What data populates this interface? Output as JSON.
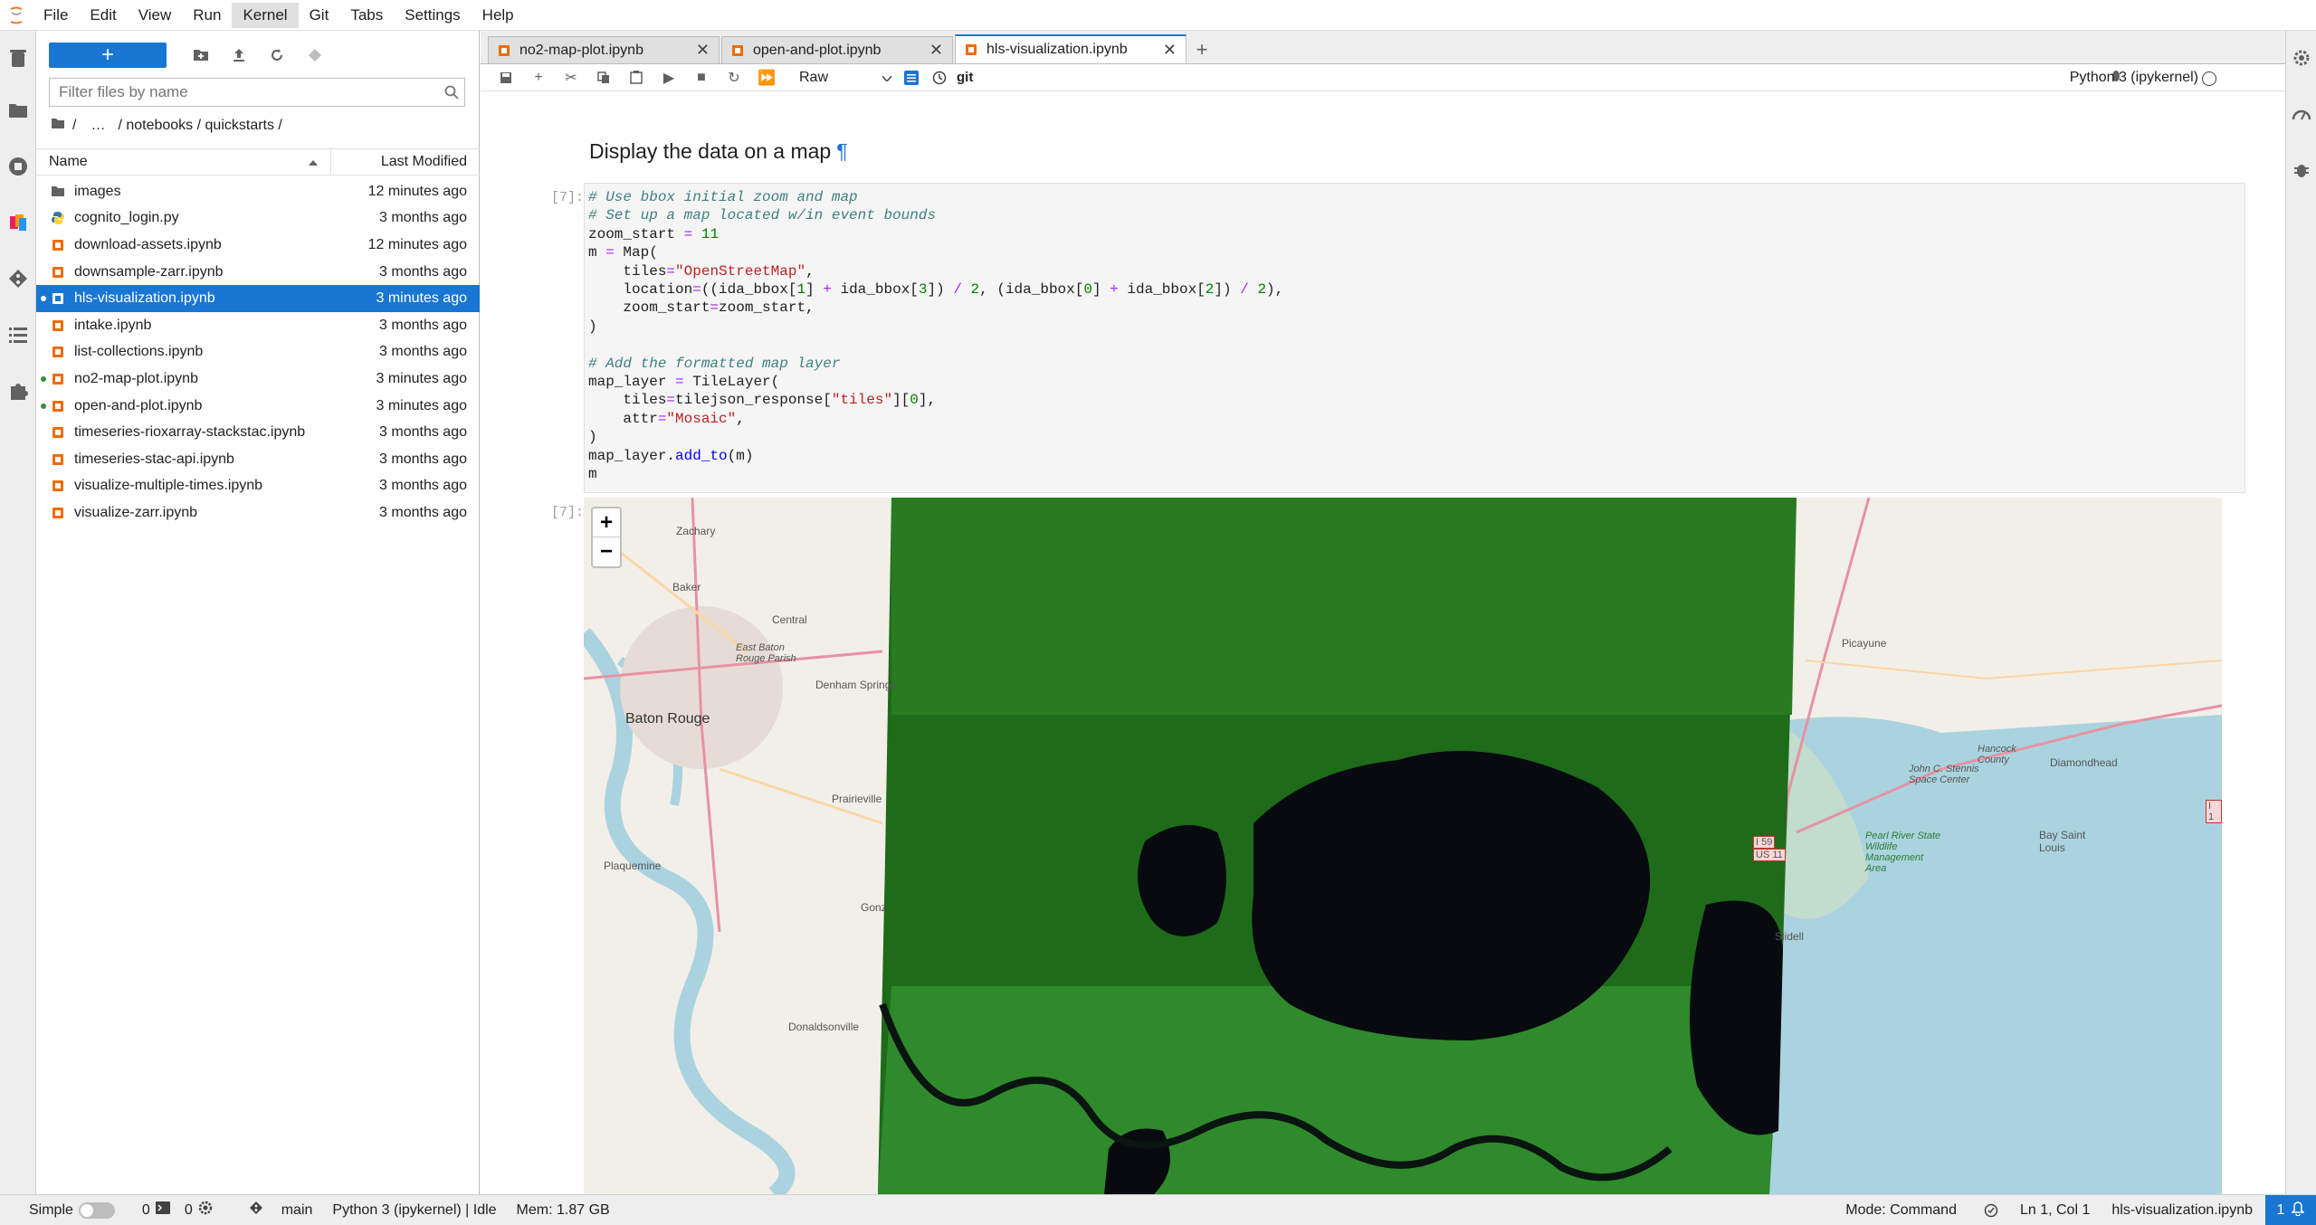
{
  "menubar": {
    "items": [
      "File",
      "Edit",
      "View",
      "Run",
      "Kernel",
      "Git",
      "Tabs",
      "Settings",
      "Help"
    ]
  },
  "filebrowser": {
    "new_label": "+",
    "filter_placeholder": "Filter files by name",
    "breadcrumb": {
      "root": "/",
      "ellipsis": "…",
      "path": "/ notebooks / quickstarts /"
    },
    "header": {
      "name": "Name",
      "modified": "Last Modified"
    },
    "files": [
      {
        "name": "images",
        "modified": "12 minutes ago",
        "type": "folder",
        "running": false,
        "selected": false
      },
      {
        "name": "cognito_login.py",
        "modified": "3 months ago",
        "type": "python",
        "running": false,
        "selected": false
      },
      {
        "name": "download-assets.ipynb",
        "modified": "12 minutes ago",
        "type": "notebook",
        "running": false,
        "selected": false
      },
      {
        "name": "downsample-zarr.ipynb",
        "modified": "3 months ago",
        "type": "notebook",
        "running": false,
        "selected": false
      },
      {
        "name": "hls-visualization.ipynb",
        "modified": "3 minutes ago",
        "type": "notebook",
        "running": true,
        "selected": true
      },
      {
        "name": "intake.ipynb",
        "modified": "3 months ago",
        "type": "notebook",
        "running": false,
        "selected": false
      },
      {
        "name": "list-collections.ipynb",
        "modified": "3 months ago",
        "type": "notebook",
        "running": false,
        "selected": false
      },
      {
        "name": "no2-map-plot.ipynb",
        "modified": "3 minutes ago",
        "type": "notebook",
        "running": true,
        "selected": false
      },
      {
        "name": "open-and-plot.ipynb",
        "modified": "3 minutes ago",
        "type": "notebook",
        "running": true,
        "selected": false
      },
      {
        "name": "timeseries-rioxarray-stackstac.ipynb",
        "modified": "3 months ago",
        "type": "notebook",
        "running": false,
        "selected": false
      },
      {
        "name": "timeseries-stac-api.ipynb",
        "modified": "3 months ago",
        "type": "notebook",
        "running": false,
        "selected": false
      },
      {
        "name": "visualize-multiple-times.ipynb",
        "modified": "3 months ago",
        "type": "notebook",
        "running": false,
        "selected": false
      },
      {
        "name": "visualize-zarr.ipynb",
        "modified": "3 months ago",
        "type": "notebook",
        "running": false,
        "selected": false
      }
    ]
  },
  "tabs": [
    {
      "label": "no2-map-plot.ipynb",
      "active": false
    },
    {
      "label": "open-and-plot.ipynb",
      "active": false
    },
    {
      "label": "hls-visualization.ipynb",
      "active": true
    }
  ],
  "nbtoolbar": {
    "cell_type": "Raw",
    "git_label": "git",
    "kernel": "Python 3 (ipykernel)"
  },
  "notebook": {
    "heading": "Display the data on a map",
    "heading_anchor": "¶",
    "code_prompt": "[7]:",
    "output_prompt": "[7]:"
  },
  "map": {
    "zoom_in": "+",
    "zoom_out": "−",
    "places": [
      "Zachary",
      "Baker",
      "Central",
      "East Baton Rouge Parish",
      "Denham Springs",
      "Baton Rouge",
      "Prairieville",
      "Plaquemine",
      "Gonz",
      "Donaldsonville",
      "Picayune",
      "Hancock County",
      "Diamondhead",
      "John C. Stennis Space Center",
      "Pearl River State Wildlife Management Area",
      "Bay Saint Louis",
      "Slidell",
      "I 59",
      "US 11",
      "I 1"
    ]
  },
  "statusbar": {
    "mode_label": "Simple",
    "terminals": "0",
    "kernels": "0",
    "branch": "main",
    "kernel_status": "Python 3 (ipykernel) | Idle",
    "memory": "Mem: 1.87 GB",
    "mode": "Mode: Command",
    "position": "Ln 1, Col 1",
    "filename": "hls-visualization.ipynb",
    "notifications": "1"
  },
  "colors": {
    "accent": "#1976d2",
    "running_dot": "#388e3c",
    "notebook_icon": "#ef6c00",
    "folder_icon": "#616161"
  }
}
